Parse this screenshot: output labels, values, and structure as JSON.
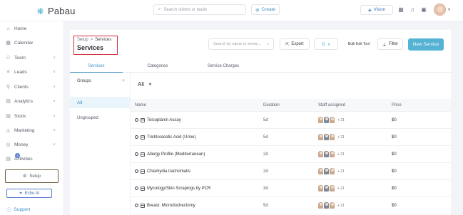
{
  "app": {
    "name": "Pabau"
  },
  "topbar": {
    "search_placeholder": "Search clients or leads",
    "create_label": "Create",
    "vision_label": "Vision"
  },
  "sidebar": {
    "items": [
      {
        "label": "Home",
        "icon": "home-icon",
        "chevron": false
      },
      {
        "label": "Calendar",
        "icon": "calendar-icon",
        "chevron": false
      },
      {
        "label": "Team",
        "icon": "team-icon",
        "chevron": true
      },
      {
        "label": "Leads",
        "icon": "leads-icon",
        "chevron": true
      },
      {
        "label": "Clients",
        "icon": "clients-icon",
        "chevron": true
      },
      {
        "label": "Analytics",
        "icon": "analytics-icon",
        "chevron": true
      },
      {
        "label": "Stock",
        "icon": "stock-icon",
        "chevron": true
      },
      {
        "label": "Marketing",
        "icon": "marketing-icon",
        "chevron": true
      },
      {
        "label": "Money",
        "icon": "money-icon",
        "chevron": true
      },
      {
        "label": "Activities",
        "icon": "activities-icon",
        "chevron": false
      }
    ],
    "activities_badge": "4",
    "setup_label": "Setup",
    "echo_label": "Echo AI",
    "support_label": "Support"
  },
  "page": {
    "breadcrumb_root": "Setup",
    "breadcrumb_sep": ">",
    "breadcrumb_current": "Services",
    "title": "Services",
    "search_placeholder": "Search by name or servic...",
    "export_label": "Export",
    "bulk_edit_label": "Bulk Edit Tool",
    "filter_label": "Filter",
    "new_service_label": "New Service"
  },
  "tabs": [
    {
      "label": "Services",
      "active": true
    },
    {
      "label": "Categories",
      "active": false
    },
    {
      "label": "Service Charges",
      "active": false
    }
  ],
  "groups": {
    "heading": "Groups",
    "all_label": "All",
    "ungrouped_label": "Ungrouped"
  },
  "filter_dropdown": {
    "selected": "All"
  },
  "table": {
    "columns": [
      "Name",
      "Duration",
      "Staff assigned",
      "Price"
    ],
    "rows": [
      {
        "name": "Teicoplanin Assay",
        "duration": "5d",
        "staff_more": "+ 21",
        "price": "$0"
      },
      {
        "name": "Trichloracetic Acid (Urine)",
        "duration": "5d",
        "staff_more": "+ 21",
        "price": "$0"
      },
      {
        "name": "Allergy Profile (Mediterranean)",
        "duration": "2d",
        "staff_more": "+ 21",
        "price": "$0"
      },
      {
        "name": "Chlamydia trachomatis",
        "duration": "2d",
        "staff_more": "+ 21",
        "price": "$0"
      },
      {
        "name": "Mycology/Skin Scrapings by PCR",
        "duration": "3d",
        "staff_more": "+ 21",
        "price": "$0"
      },
      {
        "name": "Breast: Microdochectomy",
        "duration": "5d",
        "staff_more": "+ 21",
        "price": "$0"
      }
    ]
  },
  "colors": {
    "accent": "#54b2d3",
    "link": "#3b8fc6",
    "highlight_box": "#d42a3a",
    "setup_box": "#6a5a3a"
  }
}
